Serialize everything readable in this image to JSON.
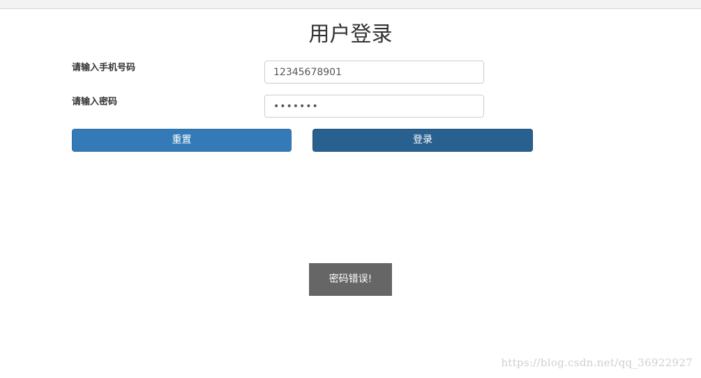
{
  "page": {
    "title": "用户登录"
  },
  "form": {
    "phone_label": "请输入手机号码",
    "phone_value": "12345678901",
    "password_label": "请输入密码",
    "password_value": "•••••••"
  },
  "buttons": {
    "reset_label": "重置",
    "login_label": "登录"
  },
  "toast": {
    "message": "密码错误!"
  },
  "watermark": {
    "text": "https://blog.csdn.net/qq_36922927"
  },
  "colors": {
    "reset_button": "#337ab7",
    "login_button": "#286090",
    "toast_background": "#666666"
  }
}
